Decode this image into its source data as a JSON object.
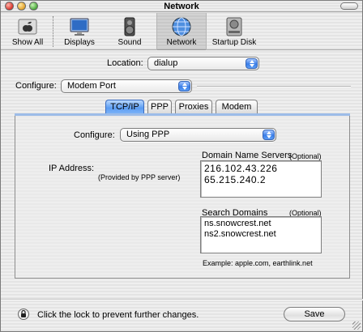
{
  "window": {
    "title": "Network"
  },
  "toolbar": {
    "items": [
      {
        "label": "Show All",
        "icon": "apple-icon"
      },
      {
        "label": "Displays",
        "icon": "display-icon"
      },
      {
        "label": "Sound",
        "icon": "speaker-icon"
      },
      {
        "label": "Network",
        "icon": "globe-icon",
        "selected": true
      },
      {
        "label": "Startup Disk",
        "icon": "disk-icon"
      }
    ]
  },
  "location": {
    "label": "Location:",
    "value": "dialup"
  },
  "configure_port": {
    "label": "Configure:",
    "value": "Modem Port"
  },
  "tabs": [
    {
      "label": "TCP/IP",
      "active": true
    },
    {
      "label": "PPP",
      "active": false
    },
    {
      "label": "Proxies",
      "active": false
    },
    {
      "label": "Modem",
      "active": false
    }
  ],
  "tcpip": {
    "configure_label": "Configure:",
    "configure_value": "Using PPP",
    "ip_label": "IP Address:",
    "ip_note": "(Provided by PPP server)",
    "dns_label": "Domain Name Servers",
    "dns_optional": "(Optional)",
    "dns_servers": [
      "216.102.43.226",
      "65.215.240.2"
    ],
    "search_label": "Search Domains",
    "search_optional": "(Optional)",
    "search_domains": [
      "ns.snowcrest.net",
      "ns2.snowcrest.net"
    ],
    "example": "Example: apple.com, earthlink.net"
  },
  "footer": {
    "lock_text": "Click the lock to prevent further changes.",
    "save_label": "Save"
  }
}
